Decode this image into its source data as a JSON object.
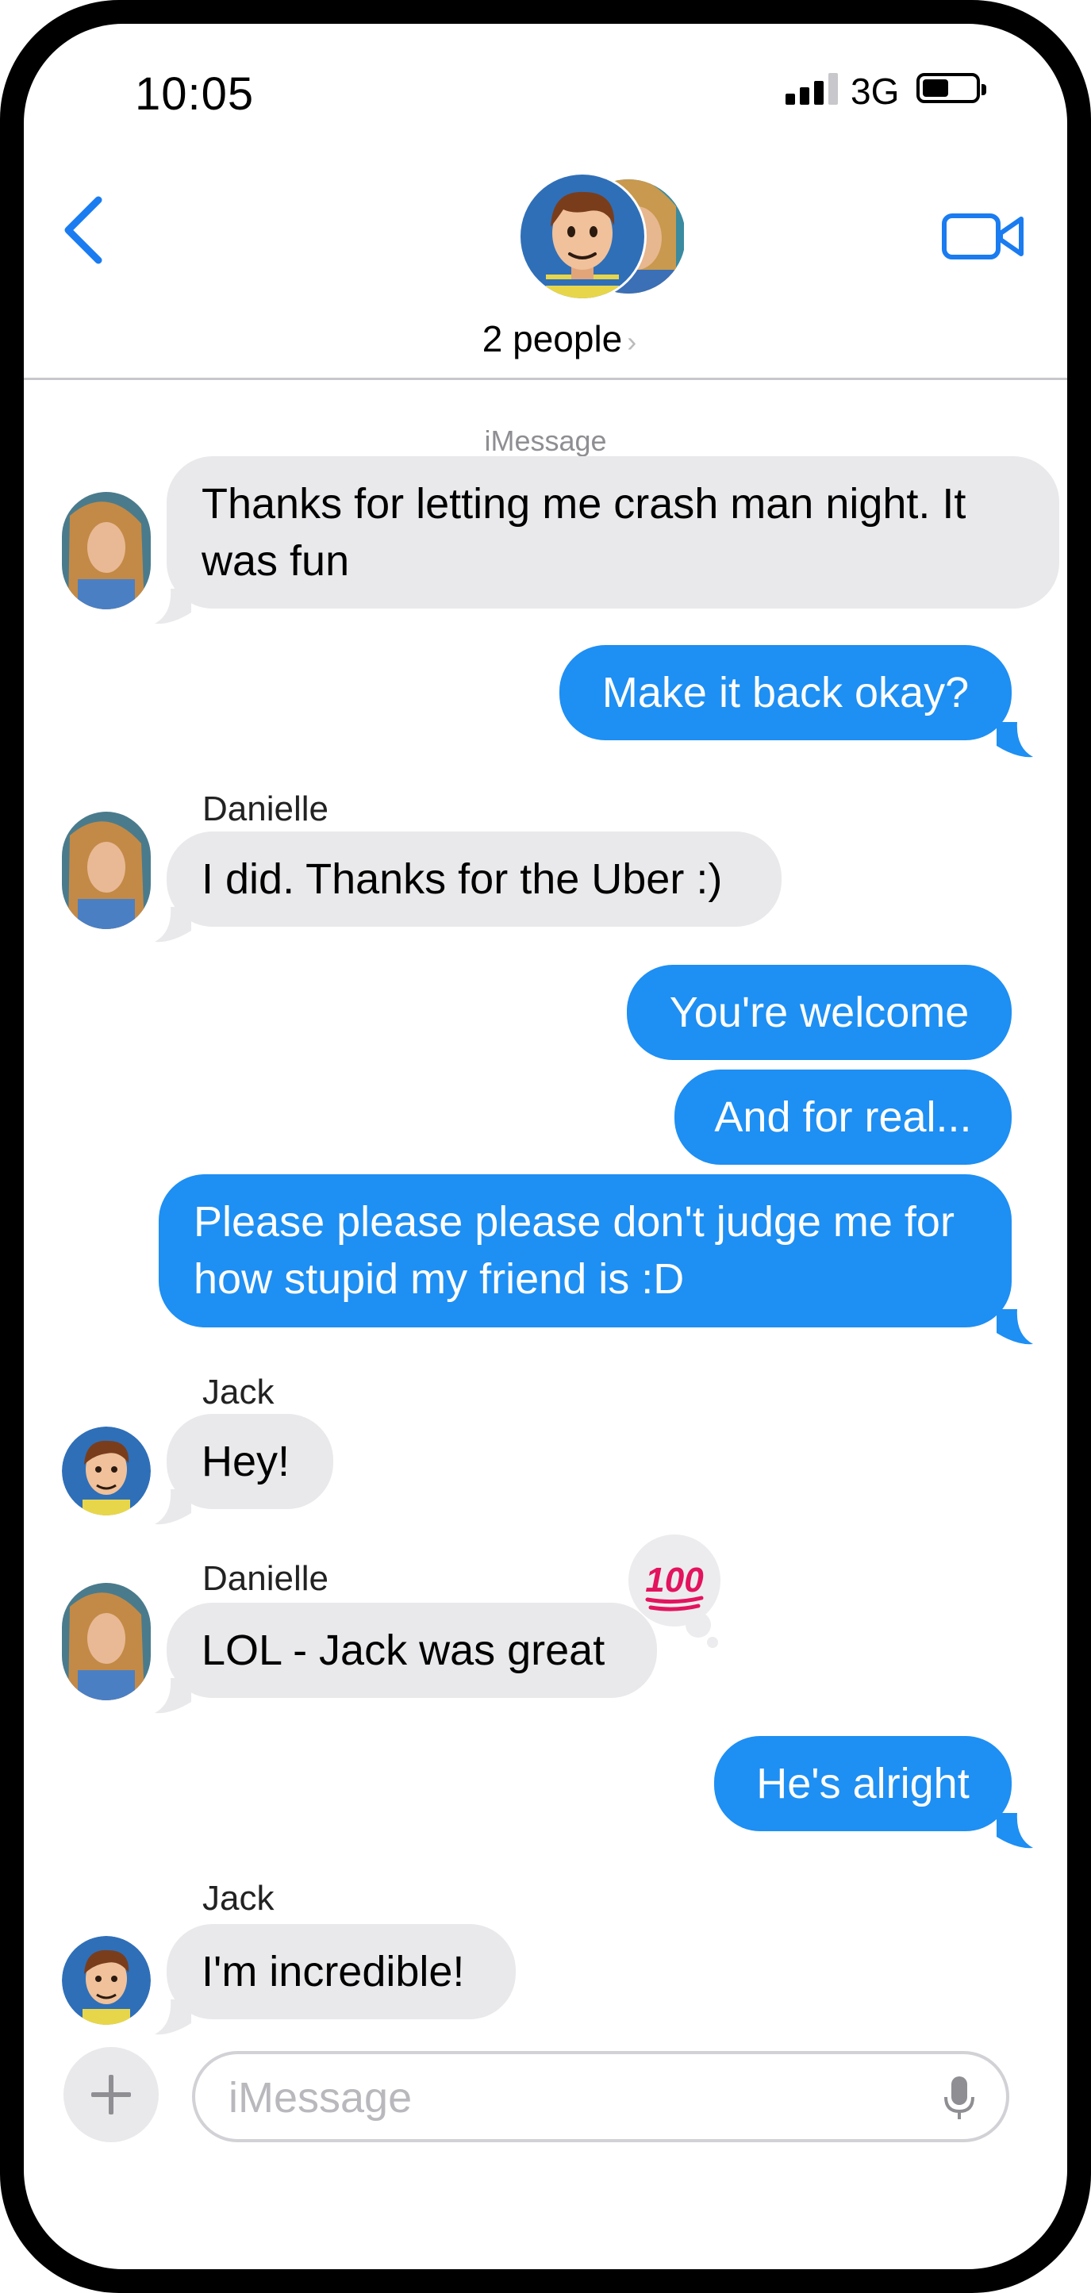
{
  "status_bar": {
    "time": "10:05",
    "network": "3G"
  },
  "header": {
    "people_label": "2 people",
    "chevron": "›"
  },
  "service_label": "iMessage",
  "messages": [
    {
      "from": "Danielle",
      "direction": "incoming",
      "text_lines": [
        "Thanks for letting me crash man night.  It",
        "was fun"
      ]
    },
    {
      "direction": "outgoing",
      "text": "Make it back okay?"
    },
    {
      "from": "Danielle",
      "direction": "incoming",
      "show_name": "Danielle",
      "text": "I did.  Thanks for the Uber :)"
    },
    {
      "direction": "outgoing",
      "text": "You're welcome"
    },
    {
      "direction": "outgoing",
      "text": "And for real..."
    },
    {
      "direction": "outgoing",
      "text_lines": [
        "Please please please don't judge me for",
        "how stupid my friend is :D"
      ]
    },
    {
      "from": "Jack",
      "direction": "incoming",
      "show_name": "Jack",
      "text": "Hey!"
    },
    {
      "from": "Danielle",
      "direction": "incoming",
      "show_name": "Danielle",
      "text": "LOL - Jack was great",
      "tapback": "100"
    },
    {
      "direction": "outgoing",
      "text": "He's alright"
    },
    {
      "from": "Jack",
      "direction": "incoming",
      "show_name": "Jack",
      "text": "I'm incredible!"
    }
  ],
  "composer": {
    "placeholder": "iMessage"
  },
  "colors": {
    "outgoing": "#1e8ff3",
    "incoming": "#e9e9eb",
    "accent": "#1a7cf0"
  }
}
